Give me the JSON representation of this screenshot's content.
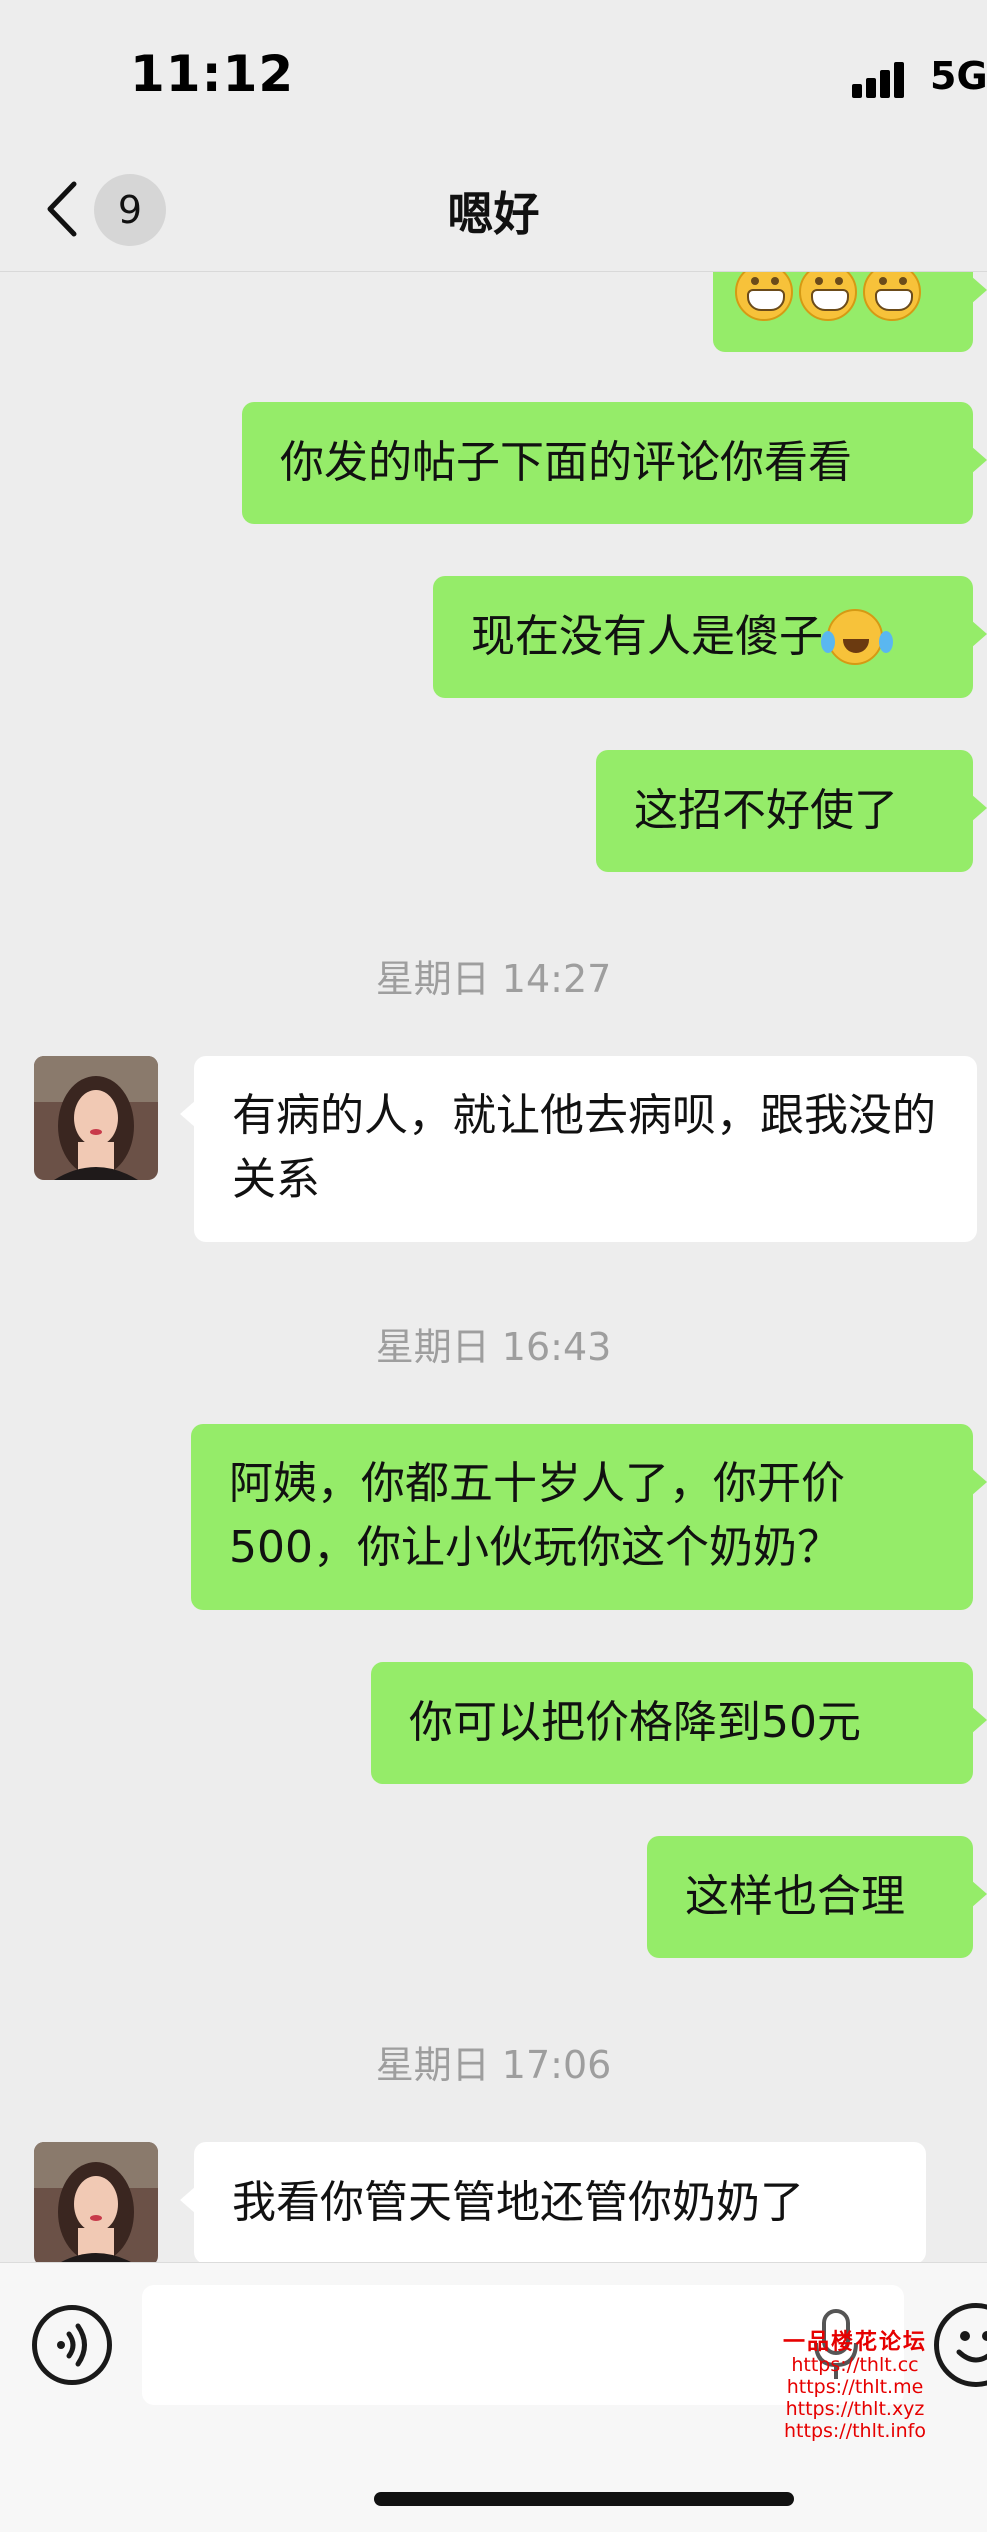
{
  "status_bar": {
    "time": "11:12",
    "network": "5G"
  },
  "nav": {
    "unread_count": "9",
    "title": "嗯好"
  },
  "messages": [
    {
      "type": "out",
      "text": "你发的帖子下面的评论你看看"
    },
    {
      "type": "out",
      "text": "现在没有人是傻子"
    },
    {
      "type": "out",
      "text": "这招不好使了"
    },
    {
      "type": "timestamp",
      "text": "星期日 14:27"
    },
    {
      "type": "in",
      "text": "有病的人，就让他去病呗，跟我没的关系"
    },
    {
      "type": "timestamp",
      "text": "星期日 16:43"
    },
    {
      "type": "out",
      "text": "阿姨，你都五十岁人了，你开价500，你让小伙玩你这个奶奶？"
    },
    {
      "type": "out",
      "text": "你可以把价格降到50元"
    },
    {
      "type": "out",
      "text": "这样也合理"
    },
    {
      "type": "timestamp",
      "text": "星期日 17:06"
    },
    {
      "type": "in",
      "text": "我看你管天管地还管你奶奶了"
    }
  ],
  "emojis": {
    "grin": "grin-emoji",
    "crying_laughing": "crying-laughing-emoji"
  },
  "watermark": {
    "title": "一品楼花论坛",
    "lines": [
      "https://thlt.cc",
      "https://thlt.me",
      "https://thlt.xyz",
      "https://thlt.info"
    ]
  },
  "colors": {
    "out_bubble": "#95ec69",
    "in_bubble": "#ffffff",
    "background": "#ededed",
    "timestamp": "#9e9e9e"
  }
}
